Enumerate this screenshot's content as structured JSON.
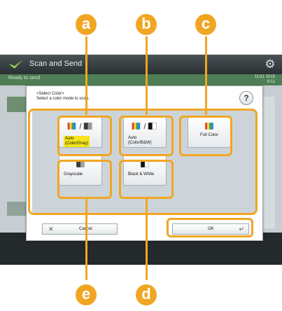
{
  "app": {
    "title": "Scan and Send",
    "breadcrumb": "Ready to send",
    "time": "11/11 2015\n9:11"
  },
  "dialog": {
    "title": "<Select Color>",
    "subtitle": "Select a color mode to scan.",
    "help_label": "?",
    "options": [
      {
        "id": "a",
        "label_line1": "Auto",
        "label_line2": "(Color/Gray)",
        "selected": true
      },
      {
        "id": "b",
        "label_line1": "Auto",
        "label_line2": "(Color/B&W)",
        "selected": false
      },
      {
        "id": "c",
        "label": "Full Color",
        "selected": false
      },
      {
        "id": "e",
        "label": "Grayscale",
        "selected": false
      },
      {
        "id": "d",
        "label": "Black & White",
        "selected": false
      }
    ],
    "cancel_label": "Cancel",
    "ok_label": "OK"
  },
  "callouts": {
    "a": "a",
    "b": "b",
    "c": "c",
    "d": "d",
    "e": "e"
  },
  "colors": {
    "callout": "#f0a623",
    "selected_label": "#f5e51a",
    "header_green": "#4f7d55"
  }
}
